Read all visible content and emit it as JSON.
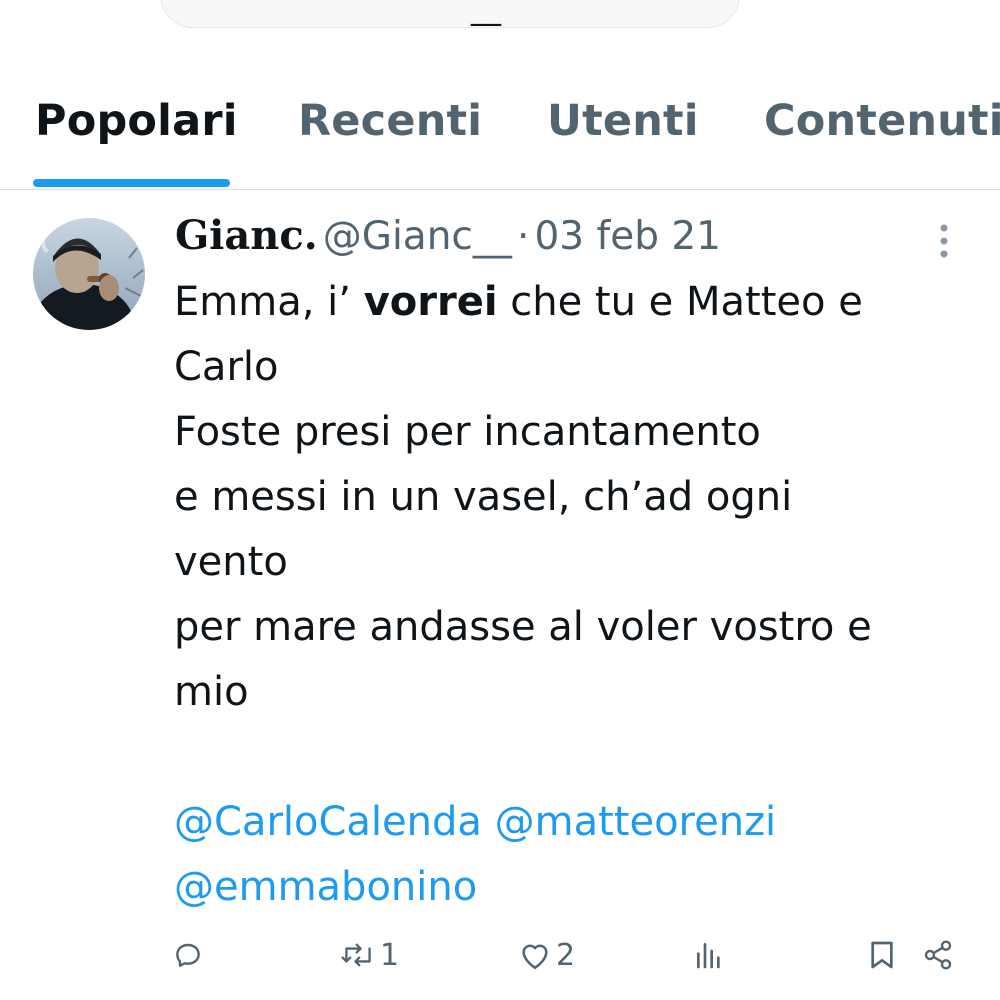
{
  "search": {
    "query": "__"
  },
  "tabs": [
    {
      "label": "Popolari",
      "active": true
    },
    {
      "label": "Recenti",
      "active": false
    },
    {
      "label": "Utenti",
      "active": false
    },
    {
      "label": "Contenuti",
      "active": false
    }
  ],
  "tweet": {
    "display_name": "Gianc.",
    "handle": "@Gianc__",
    "separator": "·",
    "date": "03 feb 21",
    "text": {
      "l1_pre": "Emma, i’ ",
      "l1_bold": "vorrei",
      "l1_post": " che tu e Matteo e",
      "l2": "Carlo",
      "l3": "Foste presi per incantamento",
      "l4": "e messi in un vasel, ch’ad ogni",
      "l5": "vento",
      "l6": "per mare andasse al voler vostro e",
      "l7": "mio"
    },
    "mentions": [
      "@CarloCalenda",
      "@matteorenzi",
      "@emmabonino"
    ],
    "stats": {
      "replies": "",
      "retweets": "1",
      "likes": "2"
    }
  },
  "icons": {
    "reply": "reply-icon",
    "retweet": "retweet-icon",
    "like": "heart-icon",
    "views": "views-icon",
    "bookmark": "bookmark-icon",
    "share": "share-icon",
    "more": "more-vertical-icon"
  },
  "colors": {
    "accent": "#1d9bf0",
    "secondary_text": "#536471",
    "primary_text": "#0f1419"
  }
}
